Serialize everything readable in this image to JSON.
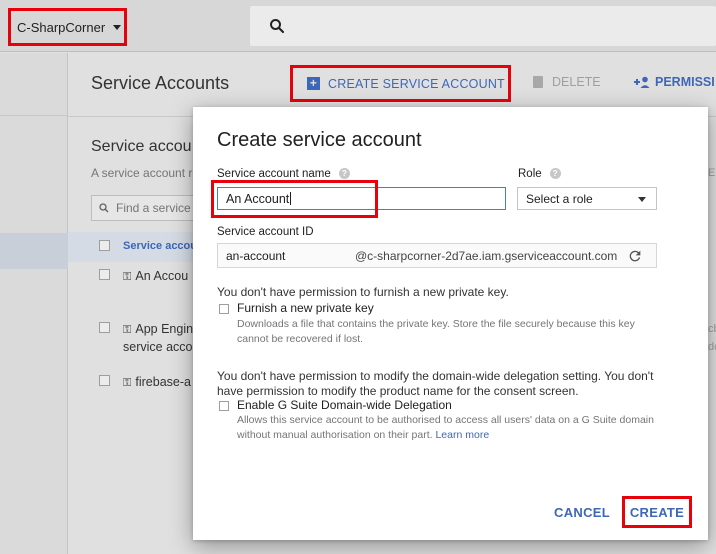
{
  "topbar": {
    "project_name": "C-SharpCorner",
    "search_icon": "search-icon"
  },
  "header": {
    "title": "Service Accounts",
    "create_label": "CREATE SERVICE ACCOUNT",
    "delete_label": "DELETE",
    "permissions_label": "PERMISSI"
  },
  "background": {
    "subtitle": "Service accou",
    "description": "A service account r",
    "filter_placeholder": "Find a service",
    "table_header": "Service accou",
    "rows": [
      {
        "line1": "An Accou",
        "line2": ""
      },
      {
        "line1": "App Engin",
        "line2": "service acco"
      },
      {
        "line1": "firebase-a",
        "line2": ""
      }
    ],
    "right_fragments": [
      "E",
      "cb",
      "dc"
    ]
  },
  "dialog": {
    "title": "Create service account",
    "name_label": "Service account name",
    "name_value": "An Account",
    "role_label": "Role",
    "role_placeholder": "Select a role",
    "id_label": "Service account ID",
    "id_value": "an-account",
    "id_suffix": "@c-sharpcorner-2d7ae.iam.gserviceaccount.com",
    "key_note": "You don't have permission to furnish a new private key.",
    "key_checkbox_label": "Furnish a new private key",
    "key_checkbox_desc": "Downloads a file that contains the private key. Store the file securely because this key cannot be recovered if lost.",
    "delegation_note": "You don't have permission to modify the domain-wide delegation setting. You don't have permission to modify the product name for the consent screen.",
    "delegation_checkbox_label": "Enable G Suite Domain-wide Delegation",
    "delegation_checkbox_desc": "Allows this service account to be authorised to access all users' data on a G Suite domain without manual authorisation on their part.",
    "learn_more": "Learn more",
    "cancel_label": "CANCEL",
    "create_label": "CREATE"
  },
  "colors": {
    "accent": "#3d67b8",
    "highlight": "#e8000b"
  }
}
